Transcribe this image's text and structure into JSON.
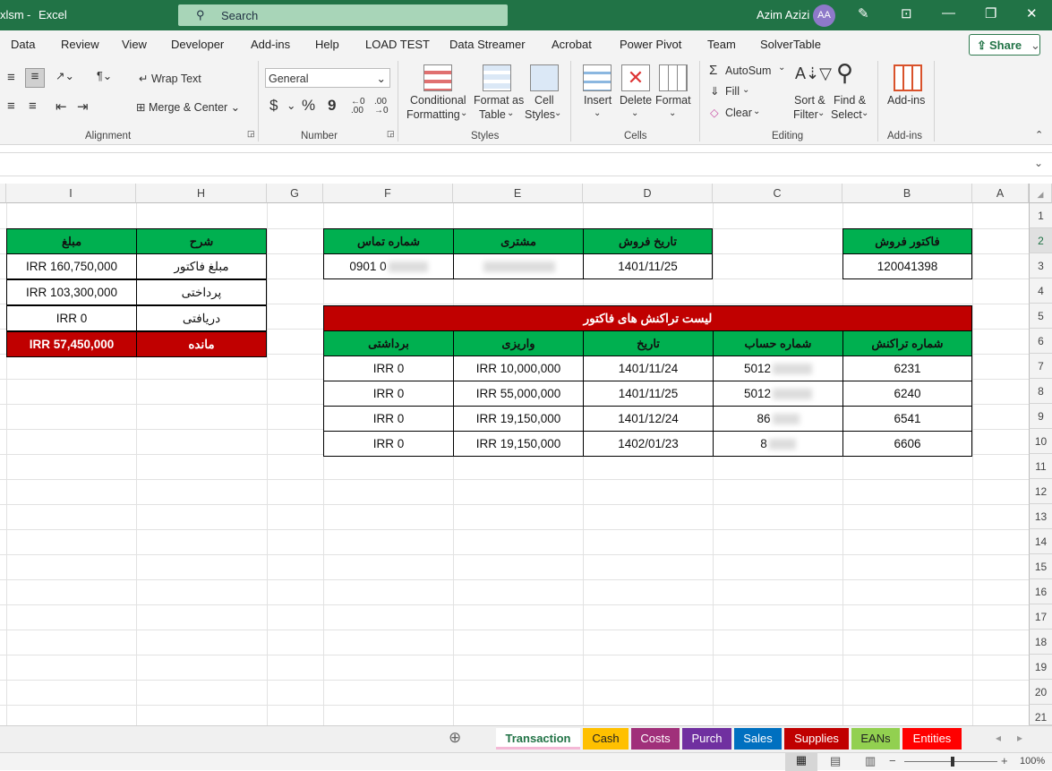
{
  "titlebar": {
    "filename": "xlsm",
    "separator": "-",
    "app": "Excel",
    "search": "Search",
    "user": "Azim Azizi",
    "initials": "AA"
  },
  "menu": [
    "Data",
    "Review",
    "View",
    "Developer",
    "Add-ins",
    "Help",
    "LOAD TEST",
    "Data Streamer",
    "Acrobat",
    "Power Pivot",
    "Team",
    "SolverTable"
  ],
  "share": "Share",
  "ribbon": {
    "wrap_text": "Wrap Text",
    "merge_center": "Merge & Center",
    "alignment": "Alignment",
    "number_format": "General",
    "currency": "$",
    "percent": "%",
    "comma": "9",
    "number": "Number",
    "conditional_1": "Conditional",
    "conditional_2": "Formatting",
    "format_table_1": "Format as",
    "format_table_2": "Table",
    "cell_styles_1": "Cell",
    "cell_styles_2": "Styles",
    "styles": "Styles",
    "insert": "Insert",
    "delete": "Delete",
    "format": "Format",
    "cells": "Cells",
    "autosum": "AutoSum",
    "fill": "Fill",
    "clear": "Clear",
    "sort_1": "Sort &",
    "sort_2": "Filter",
    "find_1": "Find &",
    "find_2": "Select",
    "editing": "Editing",
    "addins": "Add-ins",
    "addins_group": "Add-ins"
  },
  "columns": [
    "I",
    "H",
    "G",
    "F",
    "E",
    "D",
    "C",
    "B",
    "A"
  ],
  "rows": [
    "1",
    "2",
    "3",
    "4",
    "5",
    "6",
    "7",
    "8",
    "9",
    "10",
    "11",
    "12",
    "13",
    "14",
    "15",
    "16",
    "17",
    "18",
    "19",
    "20",
    "21"
  ],
  "invoice": {
    "header": "فاکتور فروش",
    "value": "120041398"
  },
  "sale_info": {
    "date_header": "تاریخ فروش",
    "customer_header": "مشتری",
    "phone_header": "شماره تماس",
    "date": "1401/11/25",
    "customer": "",
    "phone": "0901 0"
  },
  "transactions": {
    "title": "لیست تراکنش های فاکتور",
    "headers": {
      "id": "شماره تراکنش",
      "account": "شماره حساب",
      "date": "تاریخ",
      "deposit": "واریزی",
      "withdraw": "برداشتی"
    },
    "rows": [
      {
        "id": "6231",
        "account": "5012",
        "date": "1401/11/24",
        "deposit": "IRR 10,000,000",
        "withdraw": "IRR 0"
      },
      {
        "id": "6240",
        "account": "5012",
        "date": "1401/11/25",
        "deposit": "IRR 55,000,000",
        "withdraw": "IRR 0"
      },
      {
        "id": "6541",
        "account": "86",
        "date": "1401/12/24",
        "deposit": "IRR 19,150,000",
        "withdraw": "IRR 0"
      },
      {
        "id": "6606",
        "account": "8",
        "date": "1402/01/23",
        "deposit": "IRR 19,150,000",
        "withdraw": "IRR 0"
      }
    ]
  },
  "summary": {
    "desc_header": "شرح",
    "amount_header": "مبلغ",
    "rows": [
      {
        "desc": "مبلغ فاکتور",
        "amount": "IRR 160,750,000"
      },
      {
        "desc": "پرداختی",
        "amount": "IRR 103,300,000"
      },
      {
        "desc": "دریافتی",
        "amount": "IRR 0"
      },
      {
        "desc": "مانده",
        "amount": "IRR 57,450,000"
      }
    ]
  },
  "tabs": [
    {
      "label": "Transaction",
      "color": "#f4b8d6"
    },
    {
      "label": "Cash",
      "color": "#ffc000"
    },
    {
      "label": "Costs",
      "color": "#a0307a"
    },
    {
      "label": "Purch",
      "color": "#7030a0"
    },
    {
      "label": "Sales",
      "color": "#0070c0"
    },
    {
      "label": "Supplies",
      "color": "#c00000"
    },
    {
      "label": "EANs",
      "color": "#92d050"
    },
    {
      "label": "Entities",
      "color": "#ff0000"
    }
  ],
  "zoom": "100%"
}
